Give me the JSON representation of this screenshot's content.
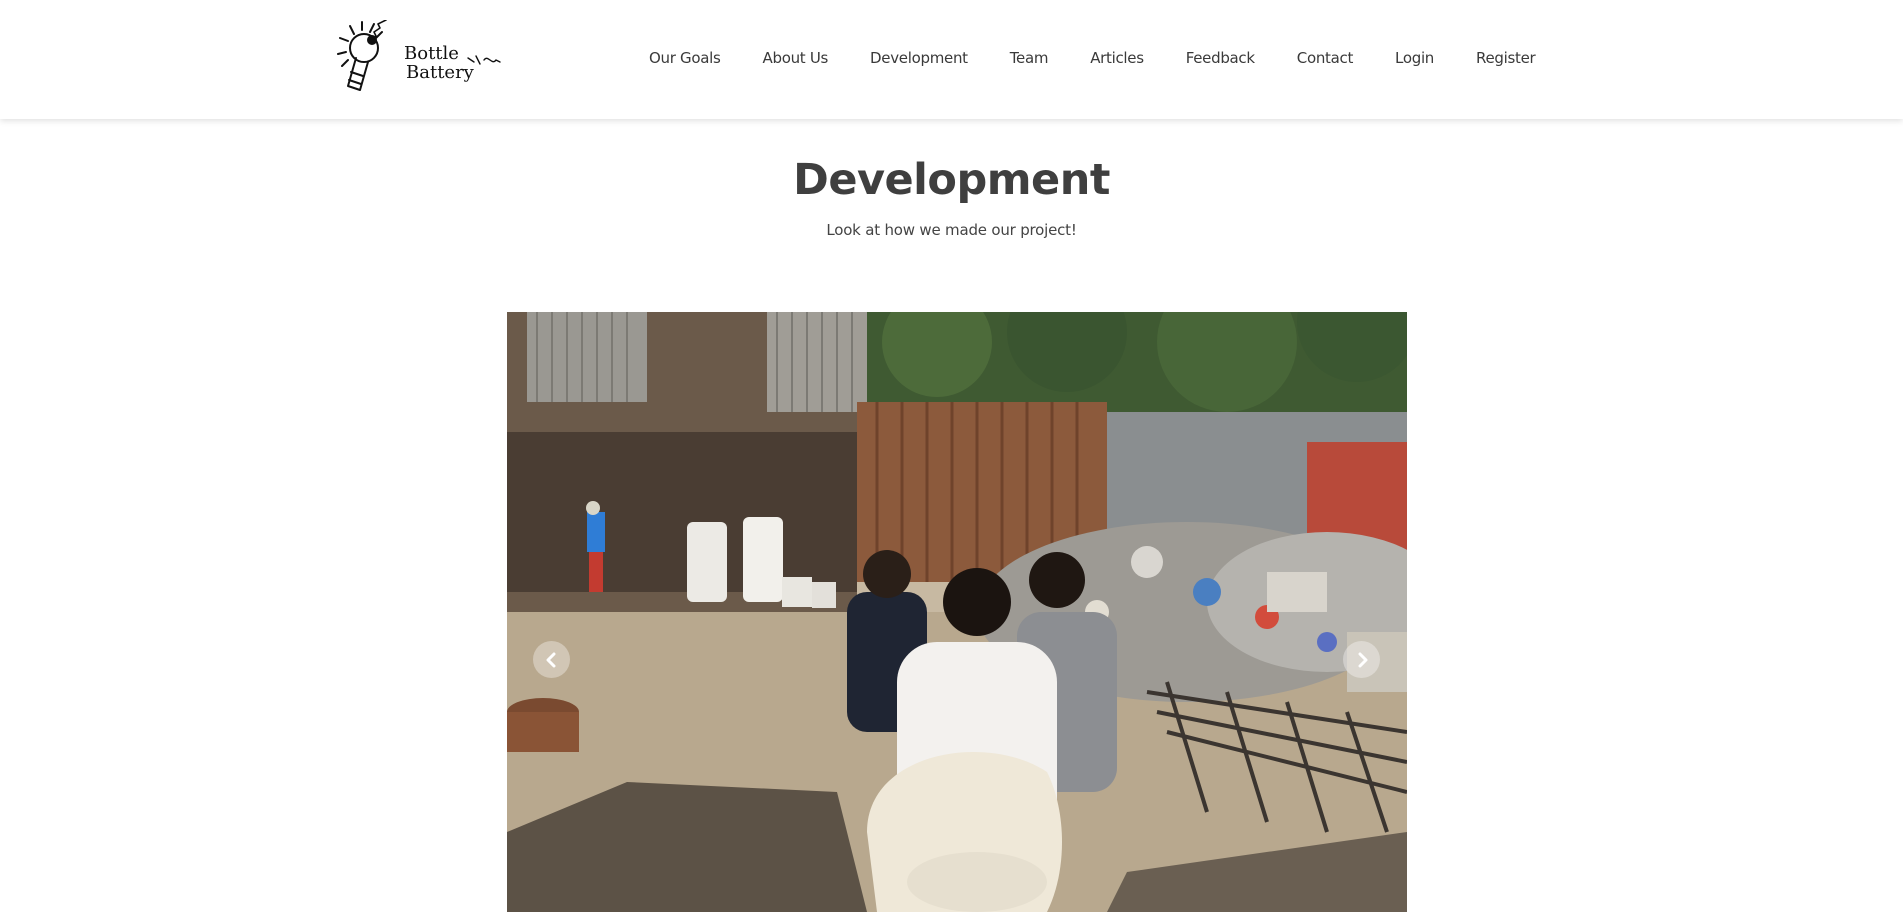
{
  "brand": {
    "name_line1": "Bottle",
    "name_line2": "Battery",
    "logo_icon": "lightbulb-bottle-icon"
  },
  "nav": {
    "items": [
      {
        "label": "Our Goals"
      },
      {
        "label": "About Us"
      },
      {
        "label": "Development"
      },
      {
        "label": "Team"
      },
      {
        "label": "Articles"
      },
      {
        "label": "Feedback"
      },
      {
        "label": "Contact"
      },
      {
        "label": "Login"
      },
      {
        "label": "Register"
      }
    ]
  },
  "section": {
    "title": "Development",
    "subtitle": "Look at how we made our project!"
  },
  "carousel": {
    "prev_icon": "chevron-left-icon",
    "next_icon": "chevron-right-icon",
    "image_alt": "Team visiting a scrap junkyard"
  },
  "colors": {
    "text": "#444444",
    "title": "#3f3f3f",
    "nav_text": "#3a3a3a",
    "background": "#ffffff"
  }
}
